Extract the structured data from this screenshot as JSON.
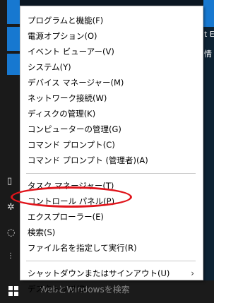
{
  "menu": {
    "groups": [
      [
        {
          "label": "プログラムと機能(F)"
        },
        {
          "label": "電源オプション(O)"
        },
        {
          "label": "イベント ビューアー(V)"
        },
        {
          "label": "システム(Y)"
        },
        {
          "label": "デバイス マネージャー(M)"
        },
        {
          "label": "ネットワーク接続(W)"
        },
        {
          "label": "ディスクの管理(K)"
        },
        {
          "label": "コンピューターの管理(G)"
        },
        {
          "label": "コマンド プロンプト(C)"
        },
        {
          "label": "コマンド プロンプト (管理者)(A)"
        }
      ],
      [
        {
          "label": "タスク マネージャー(T)"
        },
        {
          "label": "コントロール パネル(P)"
        },
        {
          "label": "エクスプローラー(E)"
        },
        {
          "label": "検索(S)"
        },
        {
          "label": "ファイル名を指定して実行(R)"
        }
      ],
      [
        {
          "label": "シャットダウンまたはサインアウト(U)",
          "has_submenu": true
        },
        {
          "label": "デスクトップ(D)"
        }
      ]
    ],
    "highlighted_item": "コントロール パネル(P)",
    "highlight_color": "#e0141b",
    "submenu_chevron": "›"
  },
  "background": {
    "right_text_top": "t E",
    "right_text_mid": "情",
    "taskbar_search_text": "WebとWindowsを検索",
    "accent_color": "#1778d0"
  }
}
